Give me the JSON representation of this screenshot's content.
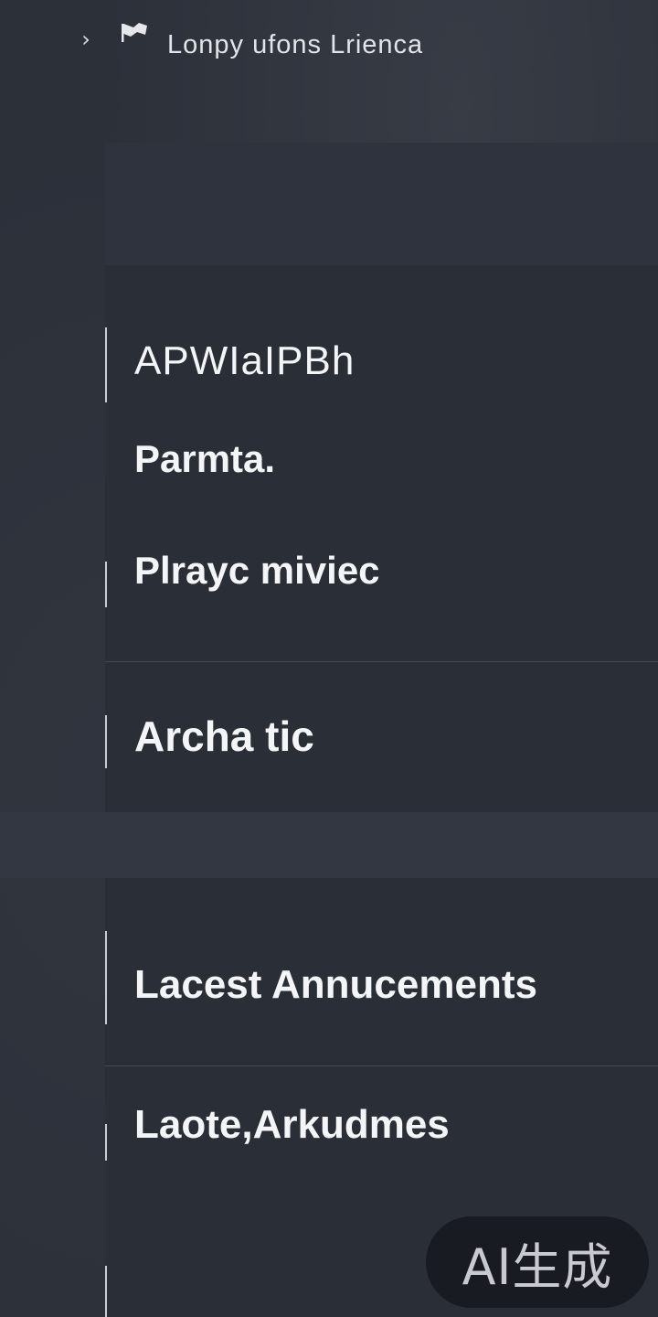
{
  "header": {
    "chevron_icon": "chevron-right-icon",
    "flag_icon": "flag-icon",
    "title": "Lonpy ufons Lrienca"
  },
  "menu": {
    "items": [
      {
        "label": "APWIaIPBh"
      },
      {
        "label": "Parmta."
      },
      {
        "label": "Plrayc miviec"
      },
      {
        "label": "Archa tic"
      }
    ]
  },
  "announcements": {
    "items": [
      {
        "label": "Lacest Annucements"
      },
      {
        "label": "Laote,Arkudmes"
      }
    ]
  },
  "watermark": {
    "text": "AI生成"
  },
  "colors": {
    "background": "#2c3039",
    "panel": "#2a2e37",
    "text": "#f4f5f7",
    "accent_bar": "#c9ccd3"
  }
}
